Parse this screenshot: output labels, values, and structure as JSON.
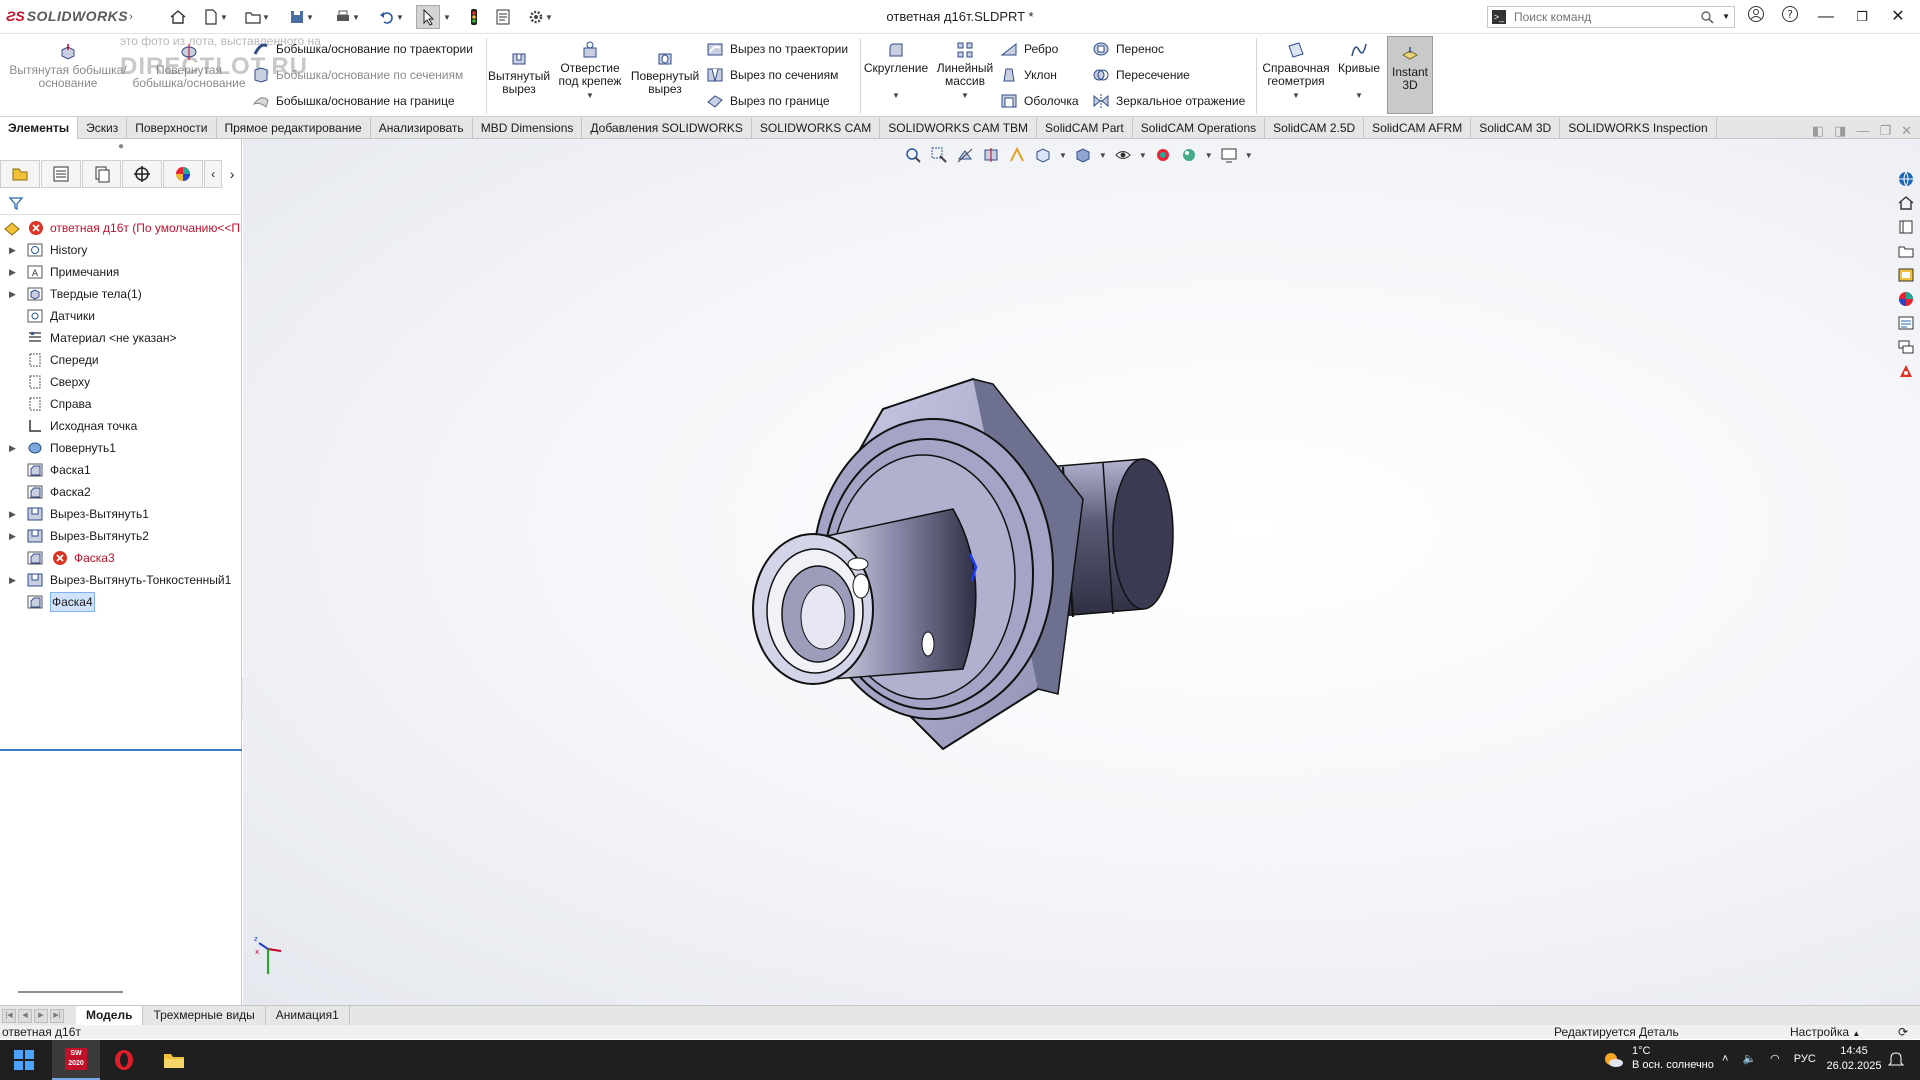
{
  "app": {
    "brand": "SOLIDWORKS",
    "document_title": "ответная д16т.SLDPRT *",
    "search_placeholder": "Поиск команд"
  },
  "watermark": {
    "line1": "это фото из лота, выставленного на",
    "line2": "DIRECTLOT.RU"
  },
  "ribbon": {
    "extrude_boss": "Вытянутая бобышка/основание",
    "revolve_boss": "Повернутая бобышка/основание",
    "sweep_boss": "Бобышка/основание по траектории",
    "loft_boss": "Бобышка/основание по сечениям",
    "boundary_boss": "Бобышка/основание на границе",
    "extrude_cut": "Вытянутый вырез",
    "hole_wizard": "Отверстие под крепеж",
    "revolve_cut": "Повернутый вырез",
    "sweep_cut": "Вырез по траектории",
    "loft_cut": "Вырез по сечениям",
    "boundary_cut": "Вырез по границе",
    "fillet": "Скругление",
    "linear_pattern": "Линейный массив",
    "rib": "Ребро",
    "draft": "Уклон",
    "shell": "Оболочка",
    "wrap": "Перенос",
    "intersect": "Пересечение",
    "mirror": "Зеркальное отражение",
    "ref_geometry": "Справочная геометрия",
    "curves": "Кривые",
    "instant3d": "Instant 3D"
  },
  "tabs": [
    "Элементы",
    "Эскиз",
    "Поверхности",
    "Прямое редактирование",
    "Анализировать",
    "MBD Dimensions",
    "Добавления SOLIDWORKS",
    "SOLIDWORKS CAM",
    "SOLIDWORKS CAM TBM",
    "SolidCAM Part",
    "SolidCAM Operations",
    "SolidCAM 2.5D",
    "SolidCAM AFRM",
    "SolidCAM 3D",
    "SOLIDWORKS Inspection"
  ],
  "tree": {
    "root": "ответная д16т  (По умолчанию<<П",
    "items": [
      "History",
      "Примечания",
      "Твердые тела(1)",
      "Датчики",
      "Материал <не указан>",
      "Спереди",
      "Сверху",
      "Справа",
      "Исходная точка",
      "Повернуть1",
      "Фаска1",
      "Фаска2",
      "Вырез-Вытянуть1",
      "Вырез-Вытянуть2",
      "Фаска3",
      "Вырез-Вытянуть-Тонкостенный1",
      "Фаска4"
    ]
  },
  "bottom_tabs": [
    "Модель",
    "Трехмерные виды",
    "Анимация1"
  ],
  "status": {
    "left": "ответная д16т",
    "mid": "Редактируется Деталь",
    "right": "Настройка"
  },
  "taskbar": {
    "sw_label": "SW 2020",
    "temp": "1°C",
    "weather": "В осн. солнечно",
    "lang": "РУС",
    "time": "14:45",
    "date": "26.02.2025"
  },
  "colors": {
    "accent": "#c0102a",
    "selection": "#cfe3ff",
    "part_body": "#a9aac8"
  }
}
